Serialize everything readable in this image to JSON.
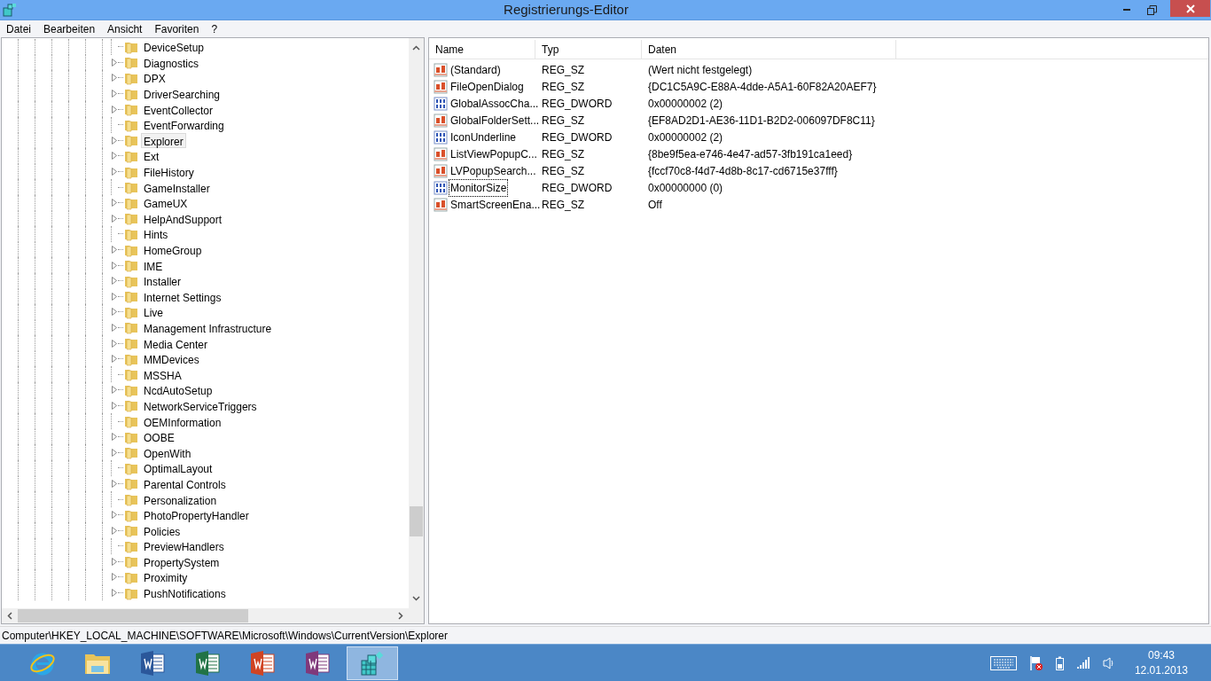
{
  "window": {
    "title": "Registrierungs-Editor"
  },
  "menu": [
    "Datei",
    "Bearbeiten",
    "Ansicht",
    "Favoriten",
    "?"
  ],
  "tree": {
    "items": [
      {
        "label": "DeviceSetup",
        "expandable": false,
        "selected": false
      },
      {
        "label": "Diagnostics",
        "expandable": true,
        "selected": false
      },
      {
        "label": "DPX",
        "expandable": true,
        "selected": false
      },
      {
        "label": "DriverSearching",
        "expandable": true,
        "selected": false
      },
      {
        "label": "EventCollector",
        "expandable": true,
        "selected": false
      },
      {
        "label": "EventForwarding",
        "expandable": false,
        "selected": false
      },
      {
        "label": "Explorer",
        "expandable": true,
        "selected": true
      },
      {
        "label": "Ext",
        "expandable": true,
        "selected": false
      },
      {
        "label": "FileHistory",
        "expandable": true,
        "selected": false
      },
      {
        "label": "GameInstaller",
        "expandable": false,
        "selected": false
      },
      {
        "label": "GameUX",
        "expandable": true,
        "selected": false
      },
      {
        "label": "HelpAndSupport",
        "expandable": true,
        "selected": false
      },
      {
        "label": "Hints",
        "expandable": false,
        "selected": false
      },
      {
        "label": "HomeGroup",
        "expandable": true,
        "selected": false
      },
      {
        "label": "IME",
        "expandable": true,
        "selected": false
      },
      {
        "label": "Installer",
        "expandable": true,
        "selected": false
      },
      {
        "label": "Internet Settings",
        "expandable": true,
        "selected": false
      },
      {
        "label": "Live",
        "expandable": true,
        "selected": false
      },
      {
        "label": "Management Infrastructure",
        "expandable": true,
        "selected": false
      },
      {
        "label": "Media Center",
        "expandable": true,
        "selected": false
      },
      {
        "label": "MMDevices",
        "expandable": true,
        "selected": false
      },
      {
        "label": "MSSHA",
        "expandable": false,
        "selected": false
      },
      {
        "label": "NcdAutoSetup",
        "expandable": true,
        "selected": false
      },
      {
        "label": "NetworkServiceTriggers",
        "expandable": true,
        "selected": false
      },
      {
        "label": "OEMInformation",
        "expandable": false,
        "selected": false
      },
      {
        "label": "OOBE",
        "expandable": true,
        "selected": false
      },
      {
        "label": "OpenWith",
        "expandable": true,
        "selected": false
      },
      {
        "label": "OptimalLayout",
        "expandable": false,
        "selected": false
      },
      {
        "label": "Parental Controls",
        "expandable": true,
        "selected": false
      },
      {
        "label": "Personalization",
        "expandable": false,
        "selected": false
      },
      {
        "label": "PhotoPropertyHandler",
        "expandable": true,
        "selected": false
      },
      {
        "label": "Policies",
        "expandable": true,
        "selected": false
      },
      {
        "label": "PreviewHandlers",
        "expandable": false,
        "selected": false
      },
      {
        "label": "PropertySystem",
        "expandable": true,
        "selected": false
      },
      {
        "label": "Proximity",
        "expandable": true,
        "selected": false
      },
      {
        "label": "PushNotifications",
        "expandable": true,
        "selected": false
      }
    ]
  },
  "table": {
    "columns": [
      "Name",
      "Typ",
      "Daten"
    ],
    "rows": [
      {
        "kind": "sz",
        "name": "(Standard)",
        "type": "REG_SZ",
        "data": "(Wert nicht festgelegt)",
        "focused": false
      },
      {
        "kind": "sz",
        "name": "FileOpenDialog",
        "type": "REG_SZ",
        "data": "{DC1C5A9C-E88A-4dde-A5A1-60F82A20AEF7}",
        "focused": false
      },
      {
        "kind": "dword",
        "name": "GlobalAssocCha...",
        "type": "REG_DWORD",
        "data": "0x00000002 (2)",
        "focused": false
      },
      {
        "kind": "sz",
        "name": "GlobalFolderSett...",
        "type": "REG_SZ",
        "data": "{EF8AD2D1-AE36-11D1-B2D2-006097DF8C11}",
        "focused": false
      },
      {
        "kind": "dword",
        "name": "IconUnderline",
        "type": "REG_DWORD",
        "data": "0x00000002 (2)",
        "focused": false
      },
      {
        "kind": "sz",
        "name": "ListViewPopupC...",
        "type": "REG_SZ",
        "data": "{8be9f5ea-e746-4e47-ad57-3fb191ca1eed}",
        "focused": false
      },
      {
        "kind": "sz",
        "name": "LVPopupSearch...",
        "type": "REG_SZ",
        "data": "{fccf70c8-f4d7-4d8b-8c17-cd6715e37fff}",
        "focused": false
      },
      {
        "kind": "dword",
        "name": "MonitorSize",
        "type": "REG_DWORD",
        "data": "0x00000000 (0)",
        "focused": true
      },
      {
        "kind": "sz",
        "name": "SmartScreenEna...",
        "type": "REG_SZ",
        "data": "Off",
        "focused": false
      }
    ]
  },
  "status_bar": "Computer\\HKEY_LOCAL_MACHINE\\SOFTWARE\\Microsoft\\Windows\\CurrentVersion\\Explorer",
  "taskbar": {
    "apps": [
      {
        "kind": "browser",
        "selected": false
      },
      {
        "kind": "folder",
        "selected": false
      },
      {
        "kind": "word",
        "selected": false
      },
      {
        "kind": "excel",
        "selected": false
      },
      {
        "kind": "powerpoint",
        "selected": false
      },
      {
        "kind": "onenote",
        "selected": false
      },
      {
        "kind": "regedit",
        "selected": true
      }
    ],
    "time": "09:43",
    "date": "12.01.2013"
  }
}
